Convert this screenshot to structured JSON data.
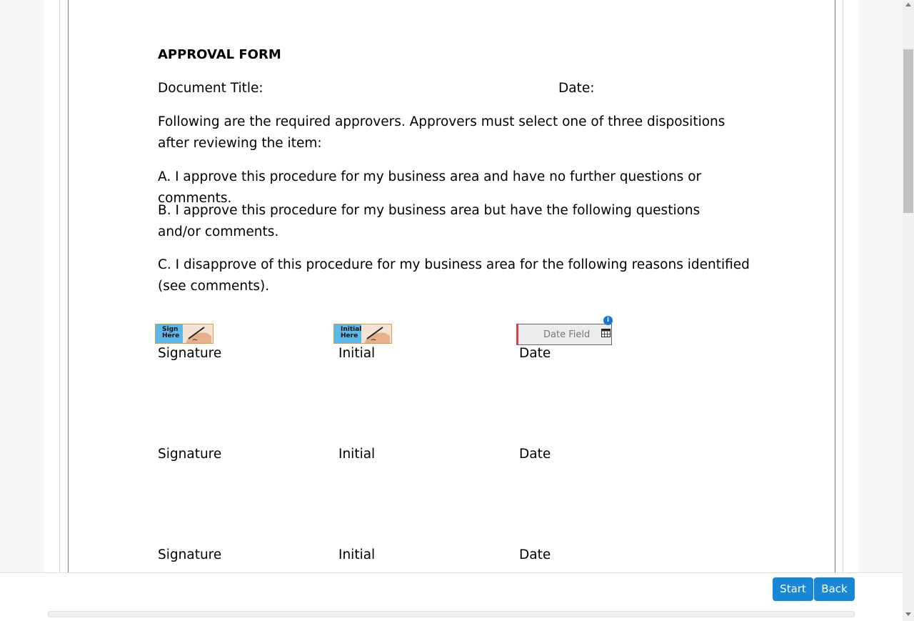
{
  "document": {
    "heading": "APPROVAL FORM",
    "document_title_label": "Document Title:",
    "date_label": "Date:",
    "intro": "Following are the required approvers. Approvers must select one of three dispositions after reviewing the item:",
    "option_a": "A. I approve this procedure for my business area and have no further questions or comments.",
    "option_b": "B. I approve this procedure for my business area but have the following questions and/or comments.",
    "option_c": "C. I disapprove of this procedure for my business area for the following reasons identified (see comments).",
    "signature_rows": [
      {
        "signature": "Signature",
        "initial": "Initial",
        "date": "Date"
      },
      {
        "signature": "Signature",
        "initial": "Initial",
        "date": "Date"
      },
      {
        "signature": "Signature",
        "initial": "Initial",
        "date": "Date"
      }
    ]
  },
  "fields": {
    "sign_here": {
      "line1": "Sign",
      "line2": "Here"
    },
    "initial_here": {
      "line1": "Initial",
      "line2": "Here"
    },
    "date_field_label": "Date Field",
    "info_icon": "info-icon",
    "calendar_icon": "calendar-icon"
  },
  "footer": {
    "start_label": "Start",
    "back_label": "Back"
  },
  "colors": {
    "button": "#1787d6",
    "tag_border": "#e39a3b",
    "tag_fill": "#5bb8e8",
    "required_marker": "#e23c3c",
    "info": "#1a73d9"
  }
}
